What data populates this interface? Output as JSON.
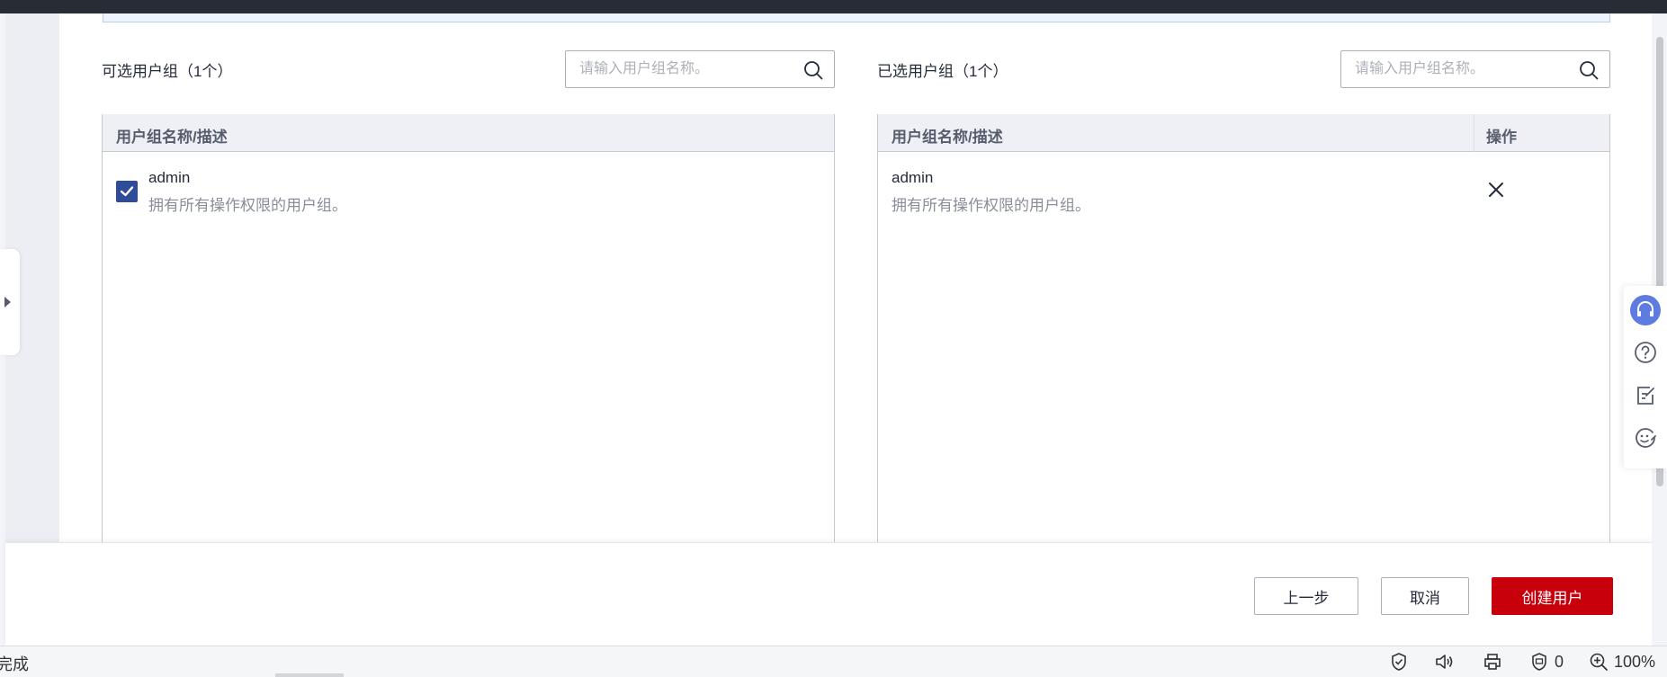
{
  "left_panel": {
    "title": "可选用户组（1个）",
    "search_placeholder": "请输入用户组名称。",
    "column_header": "用户组名称/描述",
    "rows": [
      {
        "name": "admin",
        "description": "拥有所有操作权限的用户组。",
        "checked": true
      }
    ]
  },
  "right_panel": {
    "title": "已选用户组（1个）",
    "search_placeholder": "请输入用户组名称。",
    "column_header": "用户组名称/描述",
    "action_header": "操作",
    "rows": [
      {
        "name": "admin",
        "description": "拥有所有操作权限的用户组。"
      }
    ]
  },
  "footer": {
    "prev_label": "上一步",
    "cancel_label": "取消",
    "create_label": "创建用户"
  },
  "float_tools": [
    "headset-icon",
    "help-icon",
    "edit-note-icon",
    "feedback-face-icon"
  ],
  "status_bar": {
    "text": "完成",
    "shield_count": "0",
    "zoom": "100%"
  },
  "colors": {
    "primary_red": "#c7000b",
    "checkbox_blue": "#2e4c9a",
    "header_bg": "#eef0f5",
    "tool_accent": "#5e7ce0"
  }
}
